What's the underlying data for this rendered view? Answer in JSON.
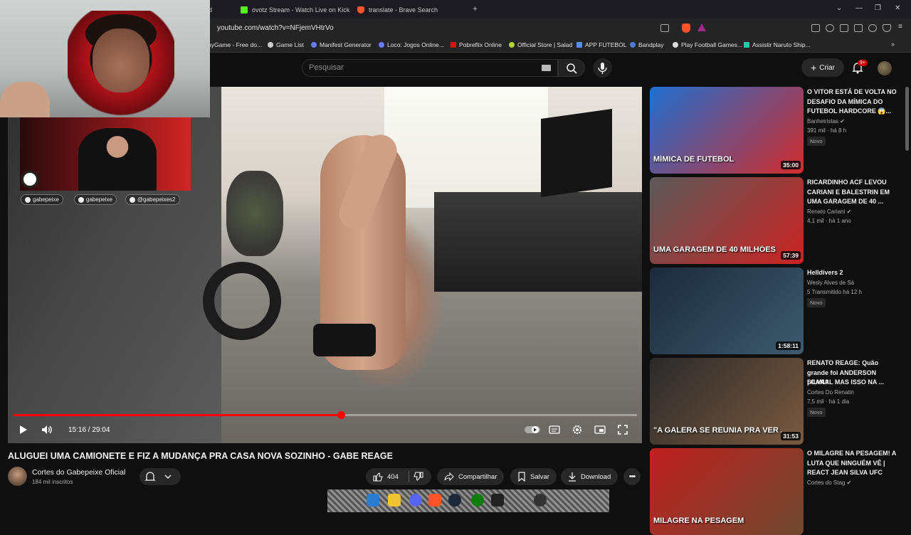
{
  "browser": {
    "tabs": [
      {
        "label": "rd",
        "icon": "youtube-icon"
      },
      {
        "label": "ovotz Stream - Watch Live on Kick",
        "icon": "kick-icon",
        "color": "#53fc18"
      },
      {
        "label": "translate - Brave Search",
        "icon": "brave-icon",
        "color": "#fb542b"
      }
    ],
    "new_tab": "+",
    "window_controls": [
      "⌄",
      "—",
      "❐",
      "✕"
    ],
    "url": "youtube.com/watch?v=NFjemVHtrVo",
    "bookmarks": [
      {
        "label": "nyGame - Free do...",
        "color": "#7a7a7a"
      },
      {
        "label": "Game List",
        "color": "#cccccc"
      },
      {
        "label": "Manifest Generator",
        "color": "#6b7cff"
      },
      {
        "label": "Loco: Jogos Online...",
        "color": "#6b7cff"
      },
      {
        "label": "Pobreflix Online",
        "color": "#e50914"
      },
      {
        "label": "Official Store | Salad",
        "color": "#b2d235"
      },
      {
        "label": "APP FUTEBOL",
        "color": "#5b8def"
      },
      {
        "label": "Bandplay",
        "color": "#4a7bd6"
      },
      {
        "label": "Play Football Games...",
        "color": "#dddddd"
      },
      {
        "label": "Assistir Naruto Ship...",
        "color": "#29c4a9"
      }
    ]
  },
  "header": {
    "search_placeholder": "Pesquisar",
    "create_label": "Criar",
    "notif_badge": "9+"
  },
  "overlay": {
    "socials": [
      "gabepeixe",
      "gabepeixe",
      "@gabepeixes2"
    ]
  },
  "player": {
    "time_current": "15:16",
    "time_sep": " / ",
    "time_total": "29:04",
    "progress": 0.525
  },
  "video": {
    "title": "ALUGUEI UMA CAMIONETE E FIZ A MUDANÇA PRA CASA NOVA SOZINHO - GABE REAGE",
    "channel": "Cortes do Gabepeixe Oficial",
    "subscribers": "184 mil inscritos",
    "likes": "404",
    "share_label": "Compartilhar",
    "save_label": "Salvar",
    "download_label": "Download"
  },
  "recommendations": [
    {
      "title_lines": [
        "O VITOR ESTÁ DE VOLTA NO",
        "DESAFIO DA MÍMICA DO",
        "FUTEBOL HARDCORE 😱..."
      ],
      "channel": "Banheiristas ✔",
      "meta": "391 mil · há 8 h",
      "badge": "Novo",
      "duration": "35:00",
      "thumb_text": "MÍMICA DE FUTEBOL",
      "colors": [
        "#1f6fd1",
        "#d22c2c"
      ]
    },
    {
      "title_lines": [
        "RICARDINHO ACF LEVOU",
        "CARIANI E BALESTRIN EM",
        "UMA GARAGEM DE 40 ..."
      ],
      "channel": "Renato Cariani ✔",
      "meta": "4,1 mil · há 1 ano",
      "badge": "",
      "duration": "57:39",
      "thumb_text": "UMA GARAGEM DE 40 MILHÕES",
      "colors": [
        "#5a5a5a",
        "#c22"
      ]
    },
    {
      "title_lines": [
        "Helldivers 2"
      ],
      "channel": "Wesly Alves de Sá",
      "meta": "5  Transmitido há 12 h",
      "badge": "Novo",
      "duration": "1:58:11",
      "thumb_text": "",
      "colors": [
        "#1b2a3a",
        "#3e5a6e"
      ]
    },
    {
      "title_lines": [
        "RENATO REAGE: Quão",
        "grande foi ANDERSON SILVA?",
        "| CANAL MAS ISSO NA ..."
      ],
      "channel": "Cortes Do Renatin",
      "meta": "7,5 mil · há 1 dia",
      "badge": "Novo",
      "duration": "31:53",
      "thumb_text": "\"A GALERA SE REUNIA PRA VER AS LUTAS!\"",
      "colors": [
        "#2a2a2a",
        "#7a5a40"
      ]
    },
    {
      "title_lines": [
        "O MILAGRE NA PESAGEM! A",
        "LUTA QUE NINGUÉM VÊ |",
        "REACT JEAN SILVA UFC"
      ],
      "channel": "Cortes do Stag ✔",
      "meta": "",
      "badge": "",
      "duration": "",
      "thumb_text": "MILAGRE NA PESAGEM",
      "colors": [
        "#c02020",
        "#6e4a30"
      ]
    }
  ]
}
